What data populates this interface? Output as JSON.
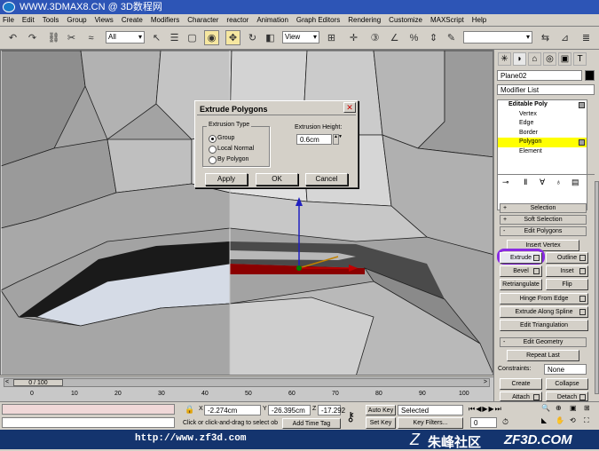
{
  "title_bar": {
    "text": "WWW.3DMAX8.CN @ 3D数程网"
  },
  "menu": [
    "File",
    "Edit",
    "Tools",
    "Group",
    "Views",
    "Create",
    "Modifiers",
    "Character",
    "reactor",
    "Animation",
    "Graph Editors",
    "Rendering",
    "Customize",
    "MAXScript",
    "Help"
  ],
  "toolbar": {
    "selection_filter": "All",
    "view_coord": "View"
  },
  "command_panel": {
    "object_name": "Plane02",
    "modifier_list": "Modifier List",
    "stack": [
      {
        "label": "Editable Poly",
        "level": 0
      },
      {
        "label": "Vertex",
        "level": 1
      },
      {
        "label": "Edge",
        "level": 1
      },
      {
        "label": "Border",
        "level": 1
      },
      {
        "label": "Polygon",
        "level": 1,
        "selected": true
      },
      {
        "label": "Element",
        "level": 1
      }
    ],
    "rollouts": {
      "selection": "Selection",
      "soft_selection": "Soft Selection",
      "edit_polygons": "Edit Polygons",
      "edit_geometry": "Edit Geometry"
    },
    "buttons": {
      "insert_vertex": "Insert Vertex",
      "extrude": "Extrude",
      "outline": "Outline",
      "bevel": "Bevel",
      "inset": "Inset",
      "retriangulate": "Retriangulate",
      "flip": "Flip",
      "hinge_from_edge": "Hinge From Edge",
      "extrude_along_spline": "Extrude Along Spline",
      "edit_triangulation": "Edit Triangulation",
      "repeat_last": "Repeat Last",
      "constraints_label": "Constraints:",
      "constraints_value": "None",
      "create": "Create",
      "collapse": "Collapse",
      "attach": "Attach",
      "detach": "Detach"
    }
  },
  "dialog": {
    "title": "Extrude Polygons",
    "group_label": "Extrusion Type",
    "options": [
      "Group",
      "Local Normal",
      "By Polygon"
    ],
    "selected_option": "Group",
    "height_label": "Extrusion Height:",
    "height_value": "0.6cm",
    "apply": "Apply",
    "ok": "OK",
    "cancel": "Cancel"
  },
  "trackbar": {
    "frame_readout": "0 / 100",
    "ticks": [
      "0",
      "10",
      "20",
      "30",
      "40",
      "50",
      "60",
      "70",
      "80",
      "90",
      "100"
    ]
  },
  "status": {
    "prompt": "Click or click-and-drag to select ob",
    "x_label": "X",
    "x_value": "-2.274cm",
    "y_label": "Y",
    "y_value": "-26.395cm",
    "z_label": "Z",
    "z_value": "-17.292",
    "auto_key": "Auto Key",
    "set_key": "Set Key",
    "selected": "Selected",
    "key_filters": "Key Filters...",
    "add_time_tag": "Add Time Tag",
    "frame": "0"
  },
  "footer": {
    "url": "http://www.zf3d.com",
    "brand_cn": "朱峰社区",
    "brand_en": "ZF3D.COM"
  },
  "colors": {
    "selection_yellow": "#ffff00",
    "highlight_purple": "#8a2be2",
    "extrude_red": "#8b0000",
    "titlebar_blue": "#2d55b6",
    "footer_blue": "#14346e"
  }
}
